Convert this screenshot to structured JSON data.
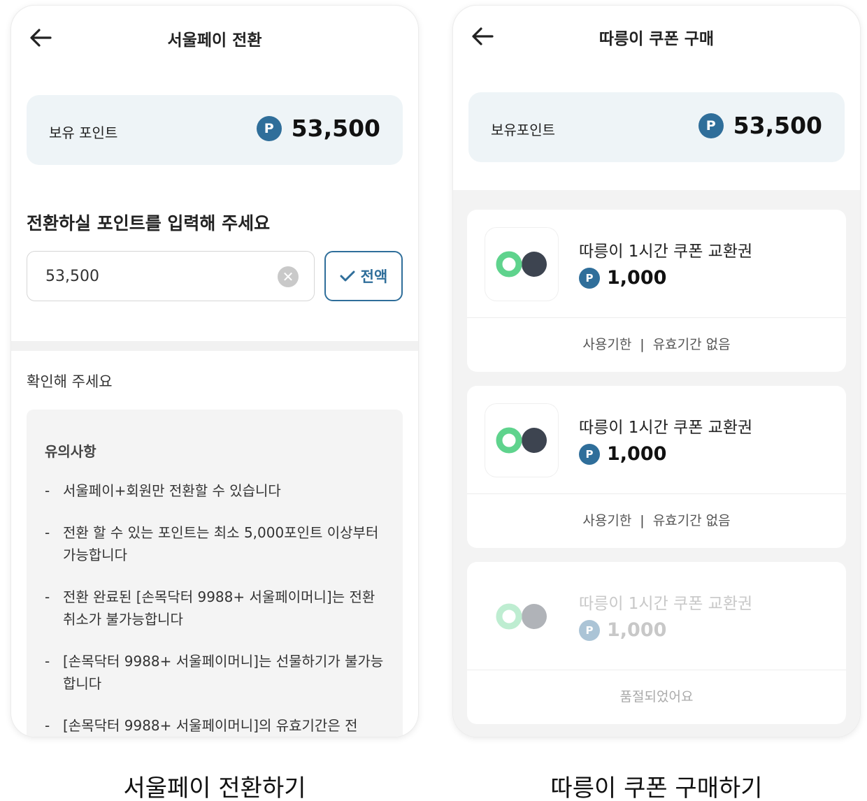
{
  "left_screen": {
    "header": {
      "title": "서울페이 전환"
    },
    "points": {
      "label": "보유 포인트",
      "badge": "P",
      "value": "53,500"
    },
    "prompt": "전환하실 포인트를 입력해 주세요",
    "input": {
      "value": "53,500",
      "clear_symbol": "✕"
    },
    "all_button": {
      "label": "전액"
    },
    "confirm_title": "확인해 주세요",
    "notice": {
      "heading": "유의사항",
      "items": [
        "서울페이+회원만 전환할 수 있습니다",
        "전환 할 수 있는 포인트는 최소 5,000포인트 이상부터 가능합니다",
        "전환 완료된 [손목닥터 9988+ 서울페이머니]는 전환 취소가 불가능합니다",
        "[손목닥터 9988+ 서울페이머니]는 선물하기가 불가능합니다",
        "[손목닥터 9988+ 서울페이머니]의 유효기간은 전"
      ]
    }
  },
  "right_screen": {
    "header": {
      "title": "따릉이 쿠폰 구매"
    },
    "points": {
      "label": "보유포인트",
      "badge": "P",
      "value": "53,500"
    },
    "coupons": [
      {
        "name": "따릉이 1시간 쿠폰 교환권",
        "badge": "P",
        "price": "1,000",
        "expiry_label": "사용기한",
        "separator": "|",
        "expiry_value": "유효기간 없음"
      },
      {
        "name": "따릉이 1시간 쿠폰 교환권",
        "badge": "P",
        "price": "1,000",
        "expiry_label": "사용기한",
        "separator": "|",
        "expiry_value": "유효기간 없음"
      },
      {
        "name": "따릉이 1시간 쿠폰 교환권",
        "badge": "P",
        "price": "1,000",
        "status": "품절되었어요"
      }
    ]
  },
  "captions": {
    "left": "서울페이 전환하기",
    "right": "따릉이 쿠폰 구매하기"
  },
  "colors": {
    "accent": "#2f6e9a",
    "card_bg": "#eef4f7",
    "logo_green": "#5fd38d",
    "logo_dark": "#3d4450"
  },
  "icons": [
    "back-arrow-icon",
    "clear-icon",
    "checkmark-icon",
    "point-badge-icon",
    "ttareungi-logo-icon"
  ]
}
